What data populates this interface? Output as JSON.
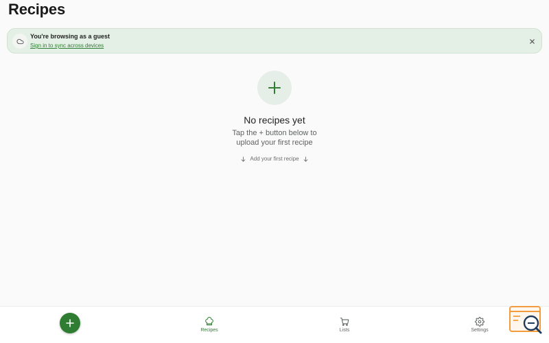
{
  "header": {
    "title": "Recipes"
  },
  "guest_banner": {
    "title": "You're browsing as a guest",
    "link": "Sign in to sync across devices",
    "icon": "cloud-icon",
    "close_icon": "close-icon"
  },
  "empty_state": {
    "icon": "plus-icon",
    "title": "No recipes yet",
    "subtitle_line1": "Tap the + button below to",
    "subtitle_line2": "upload your first recipe",
    "hint": "Add your first recipe"
  },
  "bottom_nav": {
    "fab_icon": "plus-icon",
    "items": [
      {
        "label": "Recipes",
        "icon": "chef-hat-icon",
        "active": true
      },
      {
        "label": "Lists",
        "icon": "cart-icon",
        "active": false
      },
      {
        "label": "Settings",
        "icon": "gear-icon",
        "active": false
      }
    ]
  },
  "colors": {
    "accent": "#2e7d32",
    "banner_bg": "#e4f0e5",
    "background": "#fafafa",
    "help_widget": "#f39c3d"
  }
}
